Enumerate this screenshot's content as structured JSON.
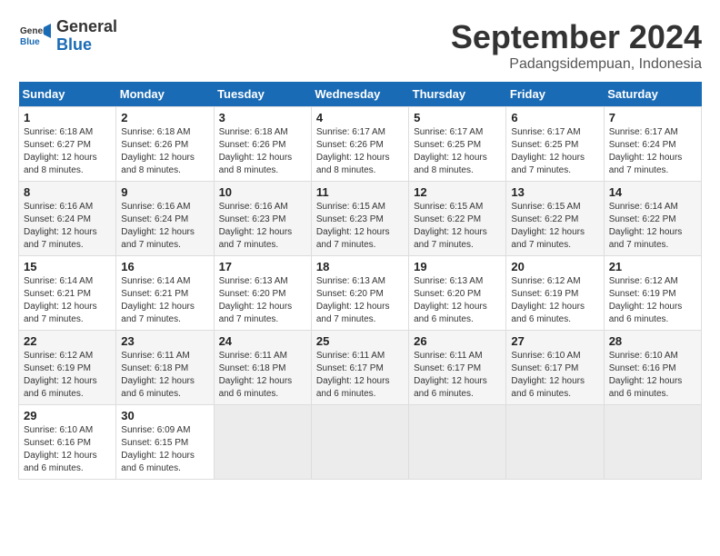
{
  "header": {
    "logo_line1": "General",
    "logo_line2": "Blue",
    "month": "September 2024",
    "location": "Padangsidempuan, Indonesia"
  },
  "columns": [
    "Sunday",
    "Monday",
    "Tuesday",
    "Wednesday",
    "Thursday",
    "Friday",
    "Saturday"
  ],
  "weeks": [
    [
      {
        "day": "1",
        "info": "Sunrise: 6:18 AM\nSunset: 6:27 PM\nDaylight: 12 hours\nand 8 minutes."
      },
      {
        "day": "2",
        "info": "Sunrise: 6:18 AM\nSunset: 6:26 PM\nDaylight: 12 hours\nand 8 minutes."
      },
      {
        "day": "3",
        "info": "Sunrise: 6:18 AM\nSunset: 6:26 PM\nDaylight: 12 hours\nand 8 minutes."
      },
      {
        "day": "4",
        "info": "Sunrise: 6:17 AM\nSunset: 6:26 PM\nDaylight: 12 hours\nand 8 minutes."
      },
      {
        "day": "5",
        "info": "Sunrise: 6:17 AM\nSunset: 6:25 PM\nDaylight: 12 hours\nand 8 minutes."
      },
      {
        "day": "6",
        "info": "Sunrise: 6:17 AM\nSunset: 6:25 PM\nDaylight: 12 hours\nand 7 minutes."
      },
      {
        "day": "7",
        "info": "Sunrise: 6:17 AM\nSunset: 6:24 PM\nDaylight: 12 hours\nand 7 minutes."
      }
    ],
    [
      {
        "day": "8",
        "info": "Sunrise: 6:16 AM\nSunset: 6:24 PM\nDaylight: 12 hours\nand 7 minutes."
      },
      {
        "day": "9",
        "info": "Sunrise: 6:16 AM\nSunset: 6:24 PM\nDaylight: 12 hours\nand 7 minutes."
      },
      {
        "day": "10",
        "info": "Sunrise: 6:16 AM\nSunset: 6:23 PM\nDaylight: 12 hours\nand 7 minutes."
      },
      {
        "day": "11",
        "info": "Sunrise: 6:15 AM\nSunset: 6:23 PM\nDaylight: 12 hours\nand 7 minutes."
      },
      {
        "day": "12",
        "info": "Sunrise: 6:15 AM\nSunset: 6:22 PM\nDaylight: 12 hours\nand 7 minutes."
      },
      {
        "day": "13",
        "info": "Sunrise: 6:15 AM\nSunset: 6:22 PM\nDaylight: 12 hours\nand 7 minutes."
      },
      {
        "day": "14",
        "info": "Sunrise: 6:14 AM\nSunset: 6:22 PM\nDaylight: 12 hours\nand 7 minutes."
      }
    ],
    [
      {
        "day": "15",
        "info": "Sunrise: 6:14 AM\nSunset: 6:21 PM\nDaylight: 12 hours\nand 7 minutes."
      },
      {
        "day": "16",
        "info": "Sunrise: 6:14 AM\nSunset: 6:21 PM\nDaylight: 12 hours\nand 7 minutes."
      },
      {
        "day": "17",
        "info": "Sunrise: 6:13 AM\nSunset: 6:20 PM\nDaylight: 12 hours\nand 7 minutes."
      },
      {
        "day": "18",
        "info": "Sunrise: 6:13 AM\nSunset: 6:20 PM\nDaylight: 12 hours\nand 7 minutes."
      },
      {
        "day": "19",
        "info": "Sunrise: 6:13 AM\nSunset: 6:20 PM\nDaylight: 12 hours\nand 6 minutes."
      },
      {
        "day": "20",
        "info": "Sunrise: 6:12 AM\nSunset: 6:19 PM\nDaylight: 12 hours\nand 6 minutes."
      },
      {
        "day": "21",
        "info": "Sunrise: 6:12 AM\nSunset: 6:19 PM\nDaylight: 12 hours\nand 6 minutes."
      }
    ],
    [
      {
        "day": "22",
        "info": "Sunrise: 6:12 AM\nSunset: 6:19 PM\nDaylight: 12 hours\nand 6 minutes."
      },
      {
        "day": "23",
        "info": "Sunrise: 6:11 AM\nSunset: 6:18 PM\nDaylight: 12 hours\nand 6 minutes."
      },
      {
        "day": "24",
        "info": "Sunrise: 6:11 AM\nSunset: 6:18 PM\nDaylight: 12 hours\nand 6 minutes."
      },
      {
        "day": "25",
        "info": "Sunrise: 6:11 AM\nSunset: 6:17 PM\nDaylight: 12 hours\nand 6 minutes."
      },
      {
        "day": "26",
        "info": "Sunrise: 6:11 AM\nSunset: 6:17 PM\nDaylight: 12 hours\nand 6 minutes."
      },
      {
        "day": "27",
        "info": "Sunrise: 6:10 AM\nSunset: 6:17 PM\nDaylight: 12 hours\nand 6 minutes."
      },
      {
        "day": "28",
        "info": "Sunrise: 6:10 AM\nSunset: 6:16 PM\nDaylight: 12 hours\nand 6 minutes."
      }
    ],
    [
      {
        "day": "29",
        "info": "Sunrise: 6:10 AM\nSunset: 6:16 PM\nDaylight: 12 hours\nand 6 minutes."
      },
      {
        "day": "30",
        "info": "Sunrise: 6:09 AM\nSunset: 6:15 PM\nDaylight: 12 hours\nand 6 minutes."
      },
      {
        "day": "",
        "info": ""
      },
      {
        "day": "",
        "info": ""
      },
      {
        "day": "",
        "info": ""
      },
      {
        "day": "",
        "info": ""
      },
      {
        "day": "",
        "info": ""
      }
    ]
  ]
}
